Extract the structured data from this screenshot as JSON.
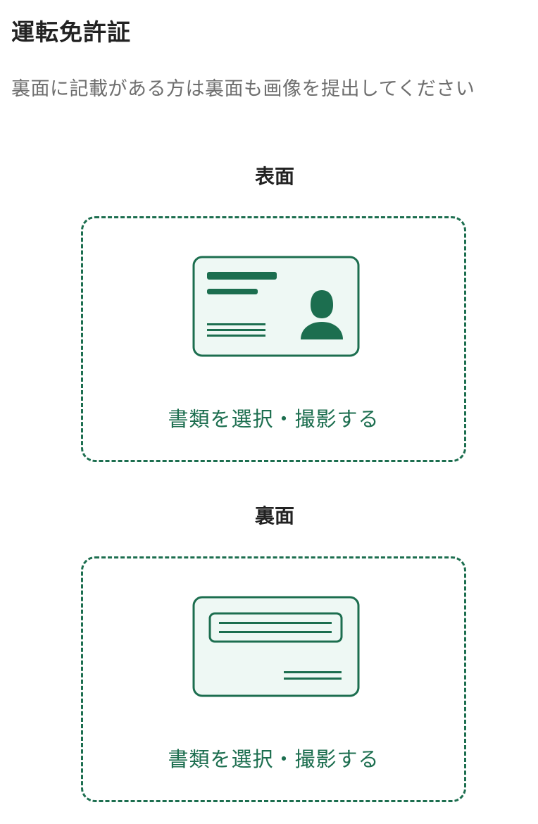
{
  "page": {
    "title": "運転免許証",
    "instruction": "裏面に記載がある方は裏面も画像を提出してください"
  },
  "front": {
    "label": "表面",
    "action_label": "書類を選択・撮影する",
    "icon": "id-card-front-icon"
  },
  "back": {
    "label": "裏面",
    "action_label": "書類を選択・撮影する",
    "icon": "id-card-back-icon"
  },
  "colors": {
    "accent": "#1c6e4f",
    "card_fill": "#eef8f4",
    "text_primary": "#222222",
    "text_secondary": "#6e6e6e"
  }
}
